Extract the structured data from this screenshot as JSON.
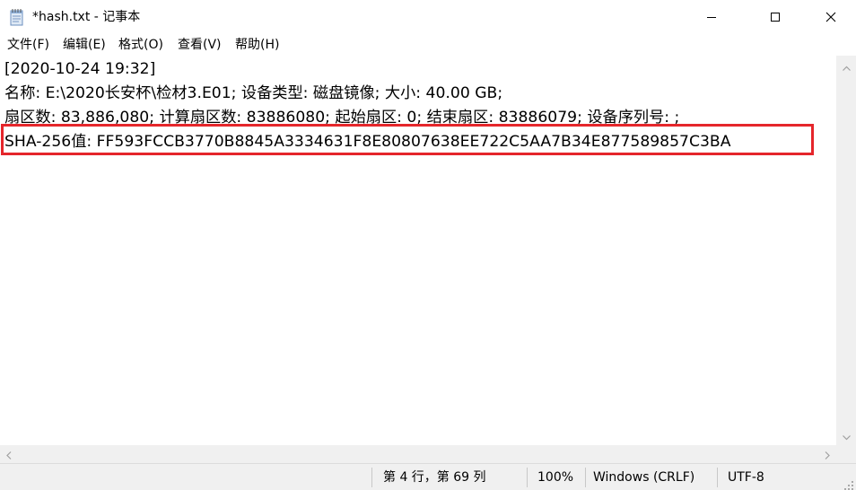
{
  "window": {
    "title": "*hash.txt - 记事本",
    "app_icon": "notepad-icon"
  },
  "caption_buttons": {
    "minimize_icon": "minimize-icon",
    "maximize_icon": "maximize-icon",
    "close_icon": "close-icon"
  },
  "menu": {
    "items": [
      {
        "label": "文件(F)"
      },
      {
        "label": "编辑(E)"
      },
      {
        "label": "格式(O)"
      },
      {
        "label": "查看(V)"
      },
      {
        "label": "帮助(H)"
      }
    ]
  },
  "editor": {
    "lines": [
      "[2020-10-24 19:32]",
      "名称: E:\\2020长安杯\\检材3.E01; 设备类型: 磁盘镜像; 大小: 40.00 GB;",
      "扇区数: 83,886,080; 计算扇区数: 83886080; 起始扇区: 0; 结束扇区: 83886079; 设备序列号: ;",
      "SHA-256值: FF593FCCB3770B8845A3334631F8E80807638EE722C5AA7B34E877589857C3BA"
    ],
    "highlight_color": "#e5262b"
  },
  "statusbar": {
    "position": "第 4 行，第 69 列",
    "zoom": "100%",
    "line_ending": "Windows (CRLF)",
    "encoding": "UTF-8"
  }
}
